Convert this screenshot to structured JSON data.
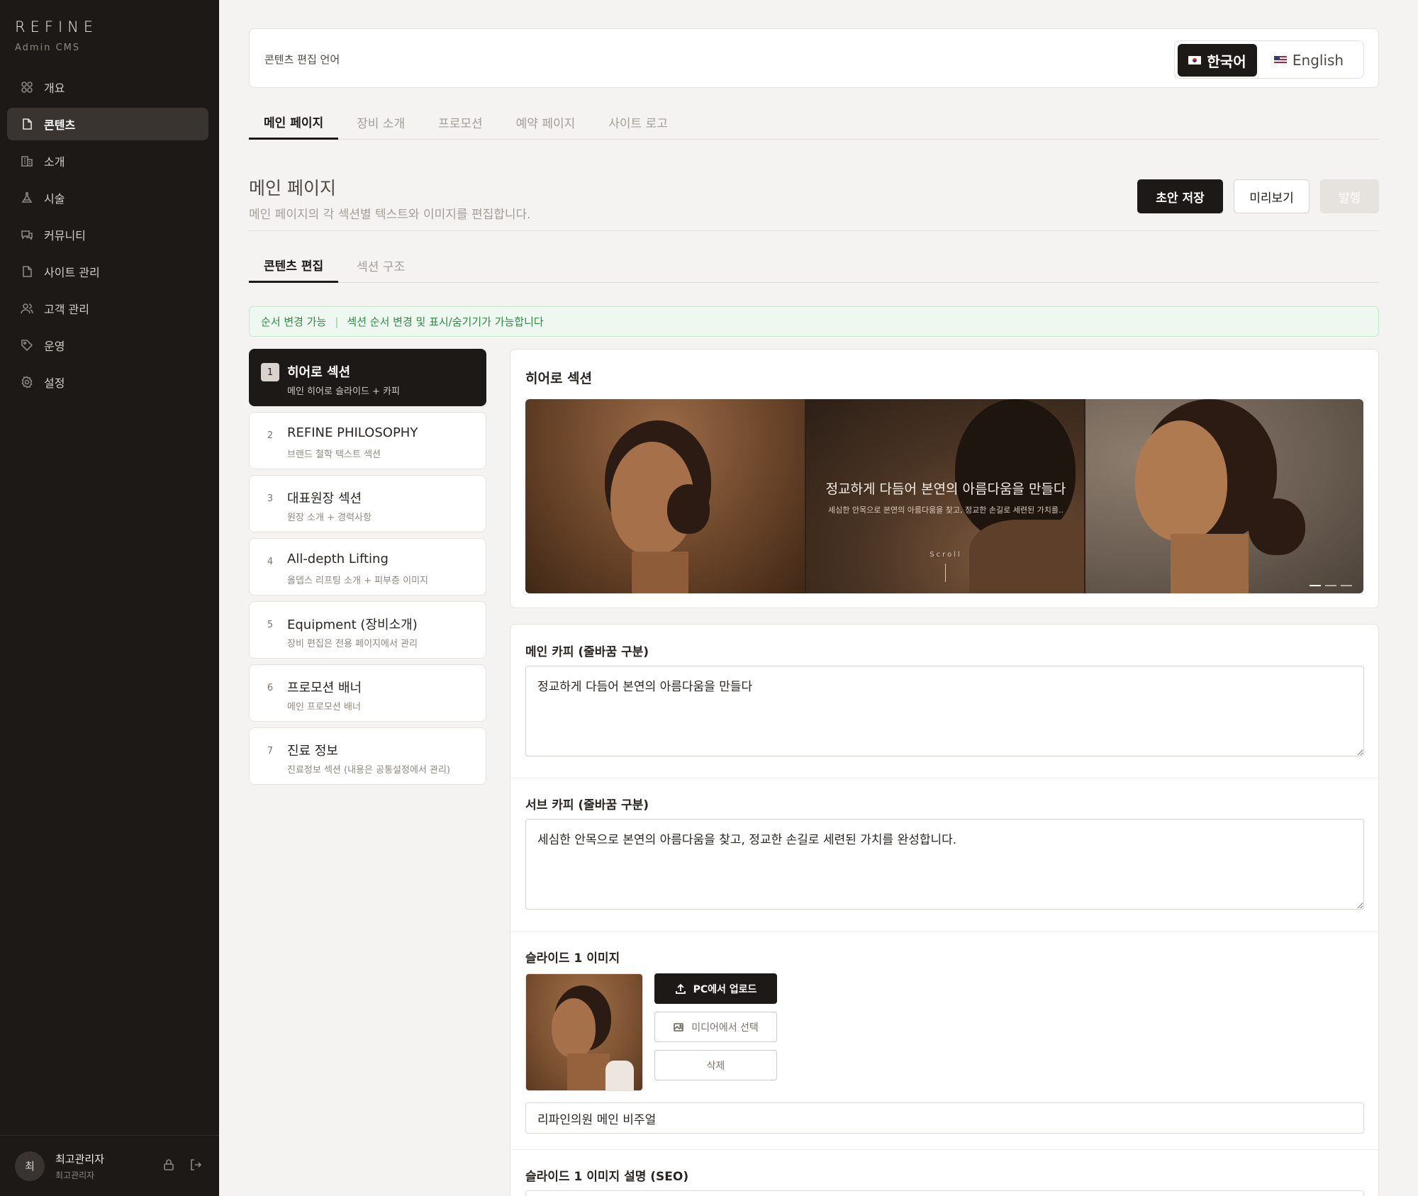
{
  "sidebar": {
    "brand": "REFINE",
    "brand_sub": "Admin CMS",
    "items": [
      {
        "label": "개요",
        "icon": "grid-icon"
      },
      {
        "label": "콘텐츠",
        "icon": "document-icon",
        "active": true
      },
      {
        "label": "소개",
        "icon": "building-icon"
      },
      {
        "label": "시술",
        "icon": "flask-icon"
      },
      {
        "label": "커뮤니티",
        "icon": "chat-icon"
      },
      {
        "label": "사이트 관리",
        "icon": "file-icon"
      },
      {
        "label": "고객 관리",
        "icon": "users-icon"
      },
      {
        "label": "운영",
        "icon": "tag-icon"
      },
      {
        "label": "설정",
        "icon": "gear-icon"
      }
    ],
    "user": {
      "initial": "최",
      "name": "최고관리자",
      "role": "최고관리자"
    }
  },
  "lang": {
    "label": "콘텐츠 편집 언어",
    "korean": "한국어",
    "english": "English"
  },
  "page_tabs": [
    "메인 페이지",
    "장비 소개",
    "프로모션",
    "예약 페이지",
    "사이트 로고"
  ],
  "header": {
    "title": "메인 페이지",
    "desc": "메인 페이지의 각 섹션별 텍스트와 이미지를 편집합니다.",
    "save": "초안 저장",
    "preview": "미리보기",
    "publish": "발행"
  },
  "sub_tabs": [
    "콘텐츠 편집",
    "섹션 구조"
  ],
  "notice": {
    "label": "순서 변경 가능",
    "sep": "|",
    "text": "섹션 순서 변경 및 표시/숨기기가 가능합니다"
  },
  "sections": [
    {
      "num": "1",
      "title": "히어로 섹션",
      "sub": "메인 히어로 슬라이드 + 카피"
    },
    {
      "num": "2",
      "title": "REFINE PHILOSOPHY",
      "sub": "브랜드 철학 텍스트 섹션"
    },
    {
      "num": "3",
      "title": "대표원장 섹션",
      "sub": "원장 소개 + 경력사항"
    },
    {
      "num": "4",
      "title": "All-depth Lifting",
      "sub": "올뎁스 리프팅 소개 + 피부층 이미지"
    },
    {
      "num": "5",
      "title": "Equipment (장비소개)",
      "sub": "장비 편집은 전용 페이지에서 관리"
    },
    {
      "num": "6",
      "title": "프로모션 배너",
      "sub": "메인 프로모션 배너"
    },
    {
      "num": "7",
      "title": "진료 정보",
      "sub": "진료정보 섹션 (내용은 공통설정에서 관리)"
    }
  ],
  "hero": {
    "title": "히어로 섹션",
    "copy": "정교하게 다듬어 본연의 아름다움을 만들다",
    "sub": "세심한 안목으로 본연의 아름다움을 찾고, 정교한 손길로 세련된 가치를..",
    "scroll": "Scroll"
  },
  "form": {
    "main_label": "메인 카피 (줄바꿈 구분)",
    "main_value": "정교하게 다듬어 본연의 아름다움을 만들다",
    "sub_label": "서브 카피 (줄바꿈 구분)",
    "sub_value": "세심한 안목으로 본연의 아름다움을 찾고, 정교한 손길로 세련된 가치를 완성합니다.",
    "slide_label": "슬라이드 1 이미지",
    "upload": "PC에서 업로드",
    "media": "미디어에서 선택",
    "delete": "삭제",
    "alt_value": "리파인의원 메인 비주얼",
    "seo_label": "슬라이드 1 이미지 설명 (SEO)"
  }
}
